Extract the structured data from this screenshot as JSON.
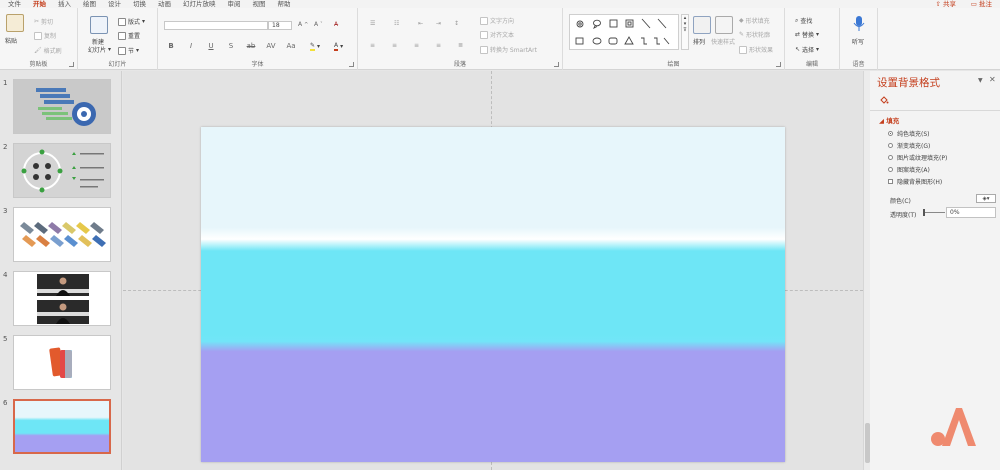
{
  "menu": {
    "tabs": [
      "文件",
      "开始",
      "插入",
      "绘图",
      "设计",
      "切换",
      "动画",
      "幻灯片放映",
      "审阅",
      "视图",
      "帮助"
    ],
    "active_tab": "开始",
    "share_label": "共享",
    "comment_label": "批注"
  },
  "ribbon": {
    "clipboard": {
      "label": "剪贴板",
      "paste": "粘贴",
      "cut": "剪切",
      "copy": "复制",
      "format_painter": "格式刷"
    },
    "slides": {
      "label": "幻灯片",
      "new_slide_line1": "新建",
      "new_slide_line2": "幻灯片",
      "layout": "版式",
      "reset": "重置",
      "section": "节"
    },
    "font": {
      "label": "字体",
      "font_size": "18",
      "format_buttons": [
        "B",
        "I",
        "U",
        "S",
        "ab",
        "AV",
        "Aa"
      ]
    },
    "paragraph": {
      "label": "段落",
      "text_direction": "文字方向",
      "align_text": "对齐文本",
      "smartart": "转换为 SmartArt"
    },
    "drawing": {
      "label": "绘图",
      "arrange": "排列",
      "quick_styles": "快速样式",
      "shape_fill": "形状填充",
      "shape_outline": "形状轮廓",
      "shape_effects": "形状效果"
    },
    "editing": {
      "label": "编辑",
      "find": "查找",
      "replace": "替换",
      "select": "选择"
    },
    "voice": {
      "label": "语音",
      "dictate": "听写"
    }
  },
  "thumbnails": {
    "numbers": [
      "1",
      "2",
      "3",
      "4",
      "5",
      "6"
    ],
    "selected_index": 6
  },
  "format_pane": {
    "title": "设置背景格式",
    "fill_section": "填充",
    "options": [
      "纯色填充(S)",
      "渐变填充(G)",
      "图片或纹理填充(P)",
      "图案填充(A)"
    ],
    "selected_option": "纯色填充(S)",
    "hide_background": "隐藏背景图形(H)",
    "color_label": "颜色(C)",
    "transparency_label": "透明度(T)",
    "transparency_value": "0%"
  },
  "colors": {
    "accent": "#c43e1c",
    "slide_band_top": "#e7f6fb",
    "slide_band_middle": "#6ee6f6",
    "slide_band_bottom": "#a59ff2"
  }
}
